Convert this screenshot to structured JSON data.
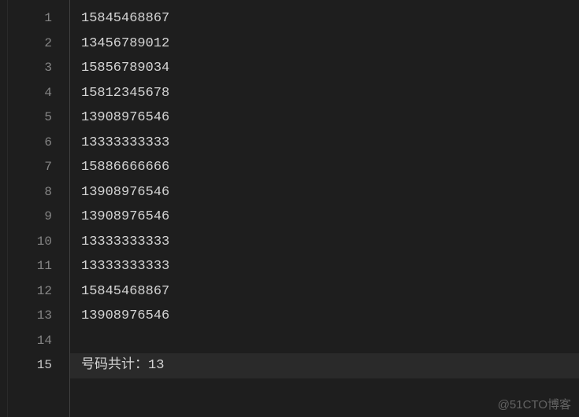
{
  "lines": [
    {
      "num": "1",
      "text": "15845468867",
      "active": false
    },
    {
      "num": "2",
      "text": "13456789012",
      "active": false
    },
    {
      "num": "3",
      "text": "15856789034",
      "active": false
    },
    {
      "num": "4",
      "text": "15812345678",
      "active": false
    },
    {
      "num": "5",
      "text": "13908976546",
      "active": false
    },
    {
      "num": "6",
      "text": "13333333333",
      "active": false
    },
    {
      "num": "7",
      "text": "15886666666",
      "active": false
    },
    {
      "num": "8",
      "text": "13908976546",
      "active": false
    },
    {
      "num": "9",
      "text": "13908976546",
      "active": false
    },
    {
      "num": "10",
      "text": "13333333333",
      "active": false
    },
    {
      "num": "11",
      "text": "13333333333",
      "active": false
    },
    {
      "num": "12",
      "text": "15845468867",
      "active": false
    },
    {
      "num": "13",
      "text": "13908976546",
      "active": false
    },
    {
      "num": "14",
      "text": "",
      "active": false
    },
    {
      "num": "15",
      "text": "号码共计：13",
      "active": true
    }
  ],
  "watermark": "@51CTO博客"
}
